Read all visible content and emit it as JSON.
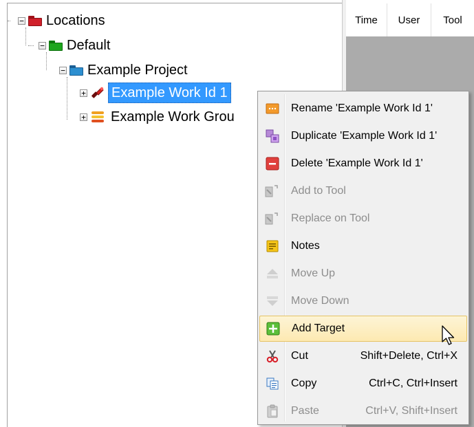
{
  "tree": {
    "root": {
      "label": "Locations",
      "expander": "−",
      "icon": "red-folder-icon",
      "color": "#d0202a"
    },
    "default": {
      "label": "Default",
      "expander": "−",
      "icon": "green-folder-icon",
      "color": "#1ea61e"
    },
    "project": {
      "label": "Example Project",
      "expander": "−",
      "icon": "blue-folder-icon",
      "color": "#2d8fd0"
    },
    "work_id": {
      "label": "Example Work Id 1",
      "expander": "+",
      "icon": "tool-red-icon"
    },
    "work_group": {
      "label": "Example Work Grou",
      "expander": "+",
      "icon": "stack-icon"
    }
  },
  "grid": {
    "columns": [
      "Time",
      "User",
      "Tool"
    ]
  },
  "context_menu": {
    "items": [
      {
        "label": "Rename 'Example Work Id 1'",
        "icon": "rename-icon",
        "enabled": true,
        "shortcut": ""
      },
      {
        "label": "Duplicate 'Example Work Id 1'",
        "icon": "duplicate-icon",
        "enabled": true,
        "shortcut": ""
      },
      {
        "label": "Delete 'Example Work Id 1'",
        "icon": "delete-icon",
        "enabled": true,
        "shortcut": ""
      },
      {
        "label": "Add to Tool",
        "icon": "add-to-tool-icon",
        "enabled": false,
        "shortcut": ""
      },
      {
        "label": "Replace on Tool",
        "icon": "replace-on-tool-icon",
        "enabled": false,
        "shortcut": ""
      },
      {
        "label": "Notes",
        "icon": "notes-icon",
        "enabled": true,
        "shortcut": ""
      },
      {
        "label": "Move Up",
        "icon": "move-up-icon",
        "enabled": false,
        "shortcut": ""
      },
      {
        "label": "Move Down",
        "icon": "move-down-icon",
        "enabled": false,
        "shortcut": ""
      },
      {
        "label": "Add Target",
        "icon": "add-target-icon",
        "enabled": true,
        "shortcut": "",
        "hovered": true
      },
      {
        "label": "Cut",
        "icon": "scissors-icon",
        "enabled": true,
        "shortcut": "Shift+Delete, Ctrl+X"
      },
      {
        "label": "Copy",
        "icon": "copy-icon",
        "enabled": true,
        "shortcut": "Ctrl+C, Ctrl+Insert"
      },
      {
        "label": "Paste",
        "icon": "paste-icon",
        "enabled": false,
        "shortcut": "Ctrl+V, Shift+Insert"
      }
    ]
  },
  "colors": {
    "selection": "#3399ff",
    "menu_hover": "#fde9b1",
    "grid_bg": "#ababab"
  }
}
